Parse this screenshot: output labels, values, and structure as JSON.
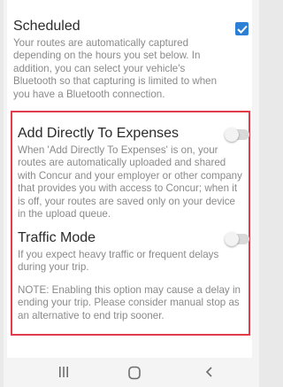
{
  "scheduled": {
    "title": "Scheduled",
    "description": "Your routes are automatically captured depending on the hours you set below. In addition, you can select your vehicle's Bluetooth so that capturing is limited to when you have a Bluetooth connection.",
    "checked": true
  },
  "add_to_expenses": {
    "title": "Add Directly To Expenses",
    "description": "When 'Add Directly To Expenses' is on, your routes are automatically uploaded and shared with Concur and your employer or other company that provides you with access to Concur; when it is off, your routes are saved only on your device in the upload queue.",
    "enabled": false
  },
  "traffic_mode": {
    "title": "Traffic Mode",
    "description": "If you expect heavy traffic or frequent delays during your trip.",
    "note": "NOTE: Enabling this option may cause a delay in ending your trip. Please consider manual stop as an alternative to end trip sooner.",
    "enabled": false
  },
  "colors": {
    "highlight": "#e23b4a",
    "checkbox": "#2b7fd4"
  },
  "nav": {
    "icons": [
      "recent-apps-icon",
      "home-icon",
      "back-icon"
    ]
  }
}
